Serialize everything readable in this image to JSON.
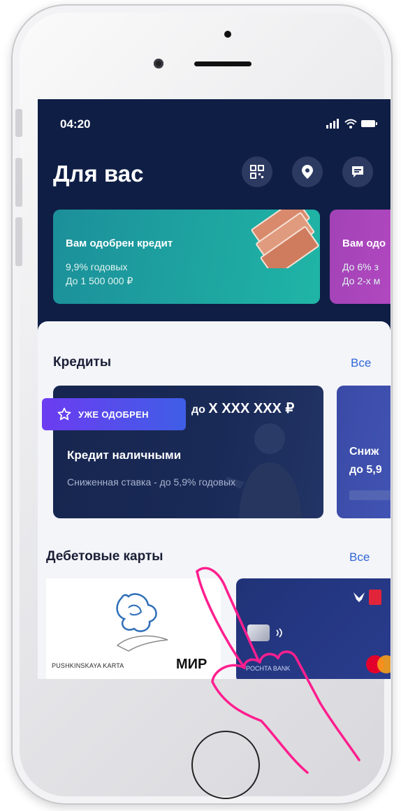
{
  "status_bar": {
    "time": "04:20"
  },
  "header": {
    "title": "Для вас"
  },
  "promos": [
    {
      "title": "Вам одобрен кредит",
      "line1": "9,9% годовых",
      "line2": "До 1 500 000 ₽"
    },
    {
      "title": "Вам одо",
      "line1": "До 6% з",
      "line2": "До 2-х м"
    }
  ],
  "credits": {
    "title": "Кредиты",
    "all_label": "Все",
    "card": {
      "badge": "УЖЕ ОДОБРЕН",
      "amount_prefix": "до",
      "amount": "X XXX XXX ₽",
      "name": "Кредит наличными",
      "description": "Сниженная ставка - до 5,9% годовых"
    },
    "card2": {
      "line1": "Сниж",
      "line2": "до 5,9"
    }
  },
  "debit": {
    "title": "Дебетовые карты",
    "all_label": "Все",
    "card1": {
      "label": "PUSHKINSKAYA KARTA",
      "brand": "МИР"
    },
    "card2": {
      "label": "POCHTA BANK"
    }
  },
  "colors": {
    "screen_bg": "#0f1e45",
    "promo_teal": "#1fb5a6",
    "promo_purple": "#b84bc5",
    "badge": "#6c3cf1",
    "link": "#2f66d8",
    "hand": "#ff1f8f"
  },
  "icons": [
    "qr-code-icon",
    "location-pin-icon",
    "chat-icon",
    "signal-icon",
    "wifi-icon",
    "battery-icon",
    "star-icon",
    "tap-gesture-hand-icon"
  ]
}
